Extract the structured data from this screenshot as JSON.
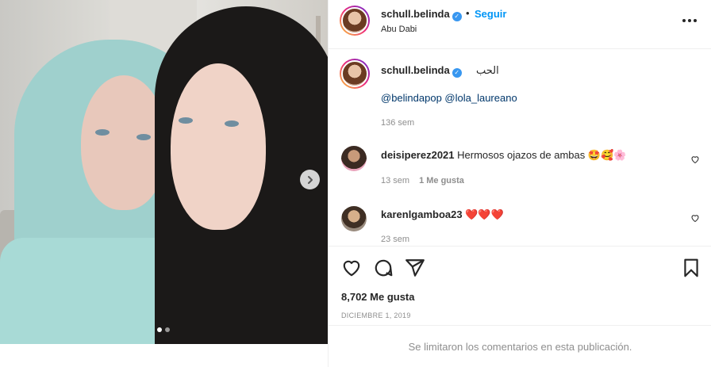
{
  "post": {
    "username": "schull.belinda",
    "separator": "•",
    "follow_label": "Seguir",
    "location": "Abu Dabi"
  },
  "caption": {
    "username": "schull.belinda",
    "text": "الحب",
    "mentions": "@belindapop @lola_laureano",
    "time": "136 sem"
  },
  "comments": [
    {
      "username": "deisiperez2021",
      "text": "Hermosos ojazos de ambas 🤩🥰🌸",
      "time": "13 sem",
      "likes": "1 Me gusta"
    },
    {
      "username": "karenlgamboa23",
      "text": "❤️❤️❤️",
      "time": "23 sem",
      "likes": ""
    }
  ],
  "stats": {
    "likes": "8,702 Me gusta",
    "date": "DICIEMBRE 1, 2019"
  },
  "footer": {
    "limited_text": "Se limitaron los comentarios en esta publicación."
  },
  "carousel": {
    "total_slides": 2,
    "current_slide": 1
  },
  "icons": {
    "verified": "verified-badge-icon",
    "more": "more-options-icon",
    "like": "heart-icon",
    "comment": "comment-bubble-icon",
    "share": "paper-plane-icon",
    "save": "bookmark-icon",
    "next": "chevron-right-icon"
  },
  "colors": {
    "accent": "#0095f6",
    "verified": "#3897f0",
    "mention": "#00376b",
    "muted": "#8e8e8e"
  }
}
